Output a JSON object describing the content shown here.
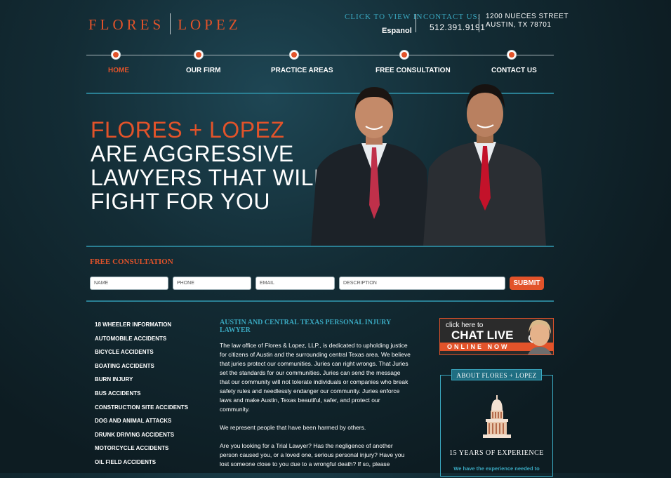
{
  "header": {
    "logo_left": "FLORES",
    "logo_right": "LOPEZ",
    "lang_label": "CLICK TO VIEW IN",
    "lang_link": "Espanol",
    "contact_label": "CONTACT US:",
    "phone": "512.391.9191",
    "address_line1": "1200 NUECES STREET",
    "address_line2": "AUSTIN, TX 78701"
  },
  "nav": {
    "items": [
      {
        "label": "HOME"
      },
      {
        "label": "OUR FIRM"
      },
      {
        "label": "PRACTICE AREAS"
      },
      {
        "label": "FREE CONSULTATION"
      },
      {
        "label": "CONTACT US"
      }
    ]
  },
  "hero": {
    "line1": "FLORES + LOPEZ",
    "line2": "ARE AGGRESSIVE",
    "line3": "LAWYERS THAT WILL",
    "line4": "FIGHT FOR YOU"
  },
  "form": {
    "title": "FREE CONSULTATION",
    "name_placeholder": "NAME",
    "phone_placeholder": "PHONE",
    "email_placeholder": "EMAIL",
    "description_placeholder": "DESCRIPTION",
    "submit_label": "SUBMIT"
  },
  "practice_list": [
    "18 WHEELER INFORMATION",
    "AUTOMOBILE ACCIDENTS",
    "BICYCLE ACCIDENTS",
    "BOATING ACCIDENTS",
    "BURN INJURY",
    "BUS ACCIDENTS",
    "CONSTRUCTION SITE ACCIDENTS",
    "DOG AND ANIMAL ATTACKS",
    "DRUNK DRIVING ACCIDENTS",
    "MOTORCYCLE ACCIDENTS",
    "OIL FIELD ACCIDENTS"
  ],
  "main": {
    "title": "AUSTIN AND CENTRAL TEXAS PERSONAL INJURY LAWYER",
    "para1": "The law office of Flores & Lopez, LLP., is dedicated to upholding justice for citizens of Austin and the surrounding central Texas area.  We believe that juries protect our communities.  Juries can right wrongs.  That Juries set the standards for our communities.  Juries can send the message that our community will not tolerate individuals or companies who break safety rules and needlessly endanger our community.  Juries enforce laws and make Austin, Texas beautiful, safer, and protect our community.",
    "para2": "We represent people that have been harmed by others.",
    "para3": "Are you looking for a Trial Lawyer? Has the negligence of another person caused you, or a loved one, serious personal injury? Have you lost someone close to you due to a wrongful death? If so, please"
  },
  "chat": {
    "line1": "click here to",
    "line2": "CHAT LIVE",
    "line3": "ONLINE NOW"
  },
  "about": {
    "title": "ABOUT FLORES + LOPEZ",
    "years": "15 YEARS OF EXPERIENCE",
    "text": "We have the experience needed to"
  },
  "colors": {
    "accent": "#e2532a",
    "teal": "#3aa8c0",
    "background": "#132c35"
  }
}
